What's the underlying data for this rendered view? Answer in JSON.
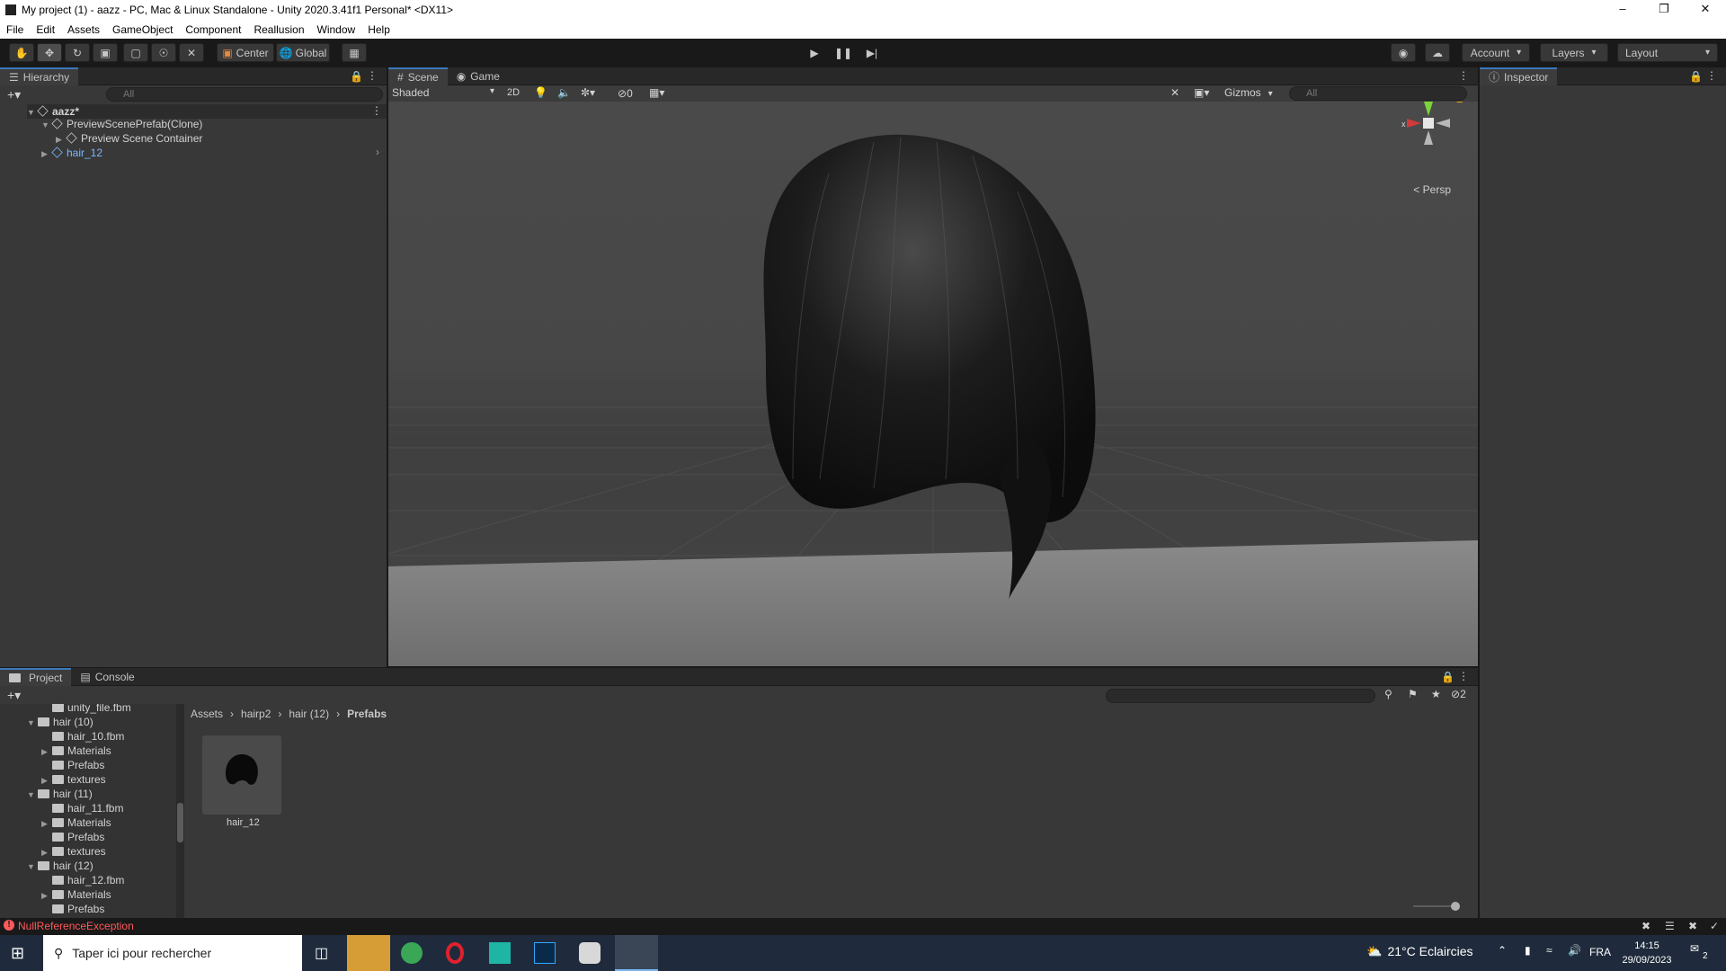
{
  "window": {
    "title": "My project (1) - aazz - PC, Mac & Linux Standalone - Unity 2020.3.41f1 Personal* <DX11>",
    "controls": [
      "–",
      "❐",
      "✕"
    ]
  },
  "menu": [
    "File",
    "Edit",
    "Assets",
    "GameObject",
    "Component",
    "Reallusion",
    "Window",
    "Help"
  ],
  "toolbar": {
    "pivot": "Center",
    "space": "Global",
    "account": "Account",
    "layers": "Layers",
    "layout": "Layout"
  },
  "hierarchy": {
    "tab": "Hierarchy",
    "search_placeholder": "All",
    "scene_name": "aazz*",
    "items": [
      {
        "label": "PreviewScenePrefab(Clone)"
      },
      {
        "label": "Preview Scene Container"
      },
      {
        "label": "hair_12"
      }
    ]
  },
  "scene": {
    "tabs": [
      "Scene",
      "Game"
    ],
    "shading": "Shaded",
    "mode_2d": "2D",
    "hidden_count": "0",
    "gizmos": "Gizmos",
    "search_placeholder": "All",
    "projection": "Persp",
    "axis_x": "x",
    "axis_y": "y"
  },
  "inspector": {
    "tab": "Inspector"
  },
  "project": {
    "tabs": [
      "Project",
      "Console"
    ],
    "hidden_count": "2",
    "breadcrumb": [
      "Assets",
      "hairp2",
      "hair (12)",
      "Prefabs"
    ],
    "tree": [
      {
        "label": "unity_file.fbm",
        "depth": 2,
        "open": null
      },
      {
        "label": "hair (10)",
        "depth": 1,
        "open": true
      },
      {
        "label": "hair_10.fbm",
        "depth": 2,
        "open": null
      },
      {
        "label": "Materials",
        "depth": 2,
        "open": false
      },
      {
        "label": "Prefabs",
        "depth": 2,
        "open": null
      },
      {
        "label": "textures",
        "depth": 2,
        "open": false
      },
      {
        "label": "hair (11)",
        "depth": 1,
        "open": true
      },
      {
        "label": "hair_11.fbm",
        "depth": 2,
        "open": null
      },
      {
        "label": "Materials",
        "depth": 2,
        "open": false
      },
      {
        "label": "Prefabs",
        "depth": 2,
        "open": null
      },
      {
        "label": "textures",
        "depth": 2,
        "open": false
      },
      {
        "label": "hair (12)",
        "depth": 1,
        "open": true
      },
      {
        "label": "hair_12.fbm",
        "depth": 2,
        "open": null
      },
      {
        "label": "Materials",
        "depth": 2,
        "open": false
      },
      {
        "label": "Prefabs",
        "depth": 2,
        "open": null
      }
    ],
    "asset": {
      "label": "hair_12"
    }
  },
  "status": {
    "error": "NullReferenceException"
  },
  "taskbar": {
    "search_placeholder": "Taper ici pour rechercher",
    "weather": "21°C  Eclaircies",
    "language": "FRA",
    "time": "14:15",
    "date": "29/09/2023",
    "notification_count": "2"
  },
  "colors": {
    "accent": "#3a79bb",
    "error": "#ff5a5a",
    "selection_blue": "#7bb8ff"
  }
}
